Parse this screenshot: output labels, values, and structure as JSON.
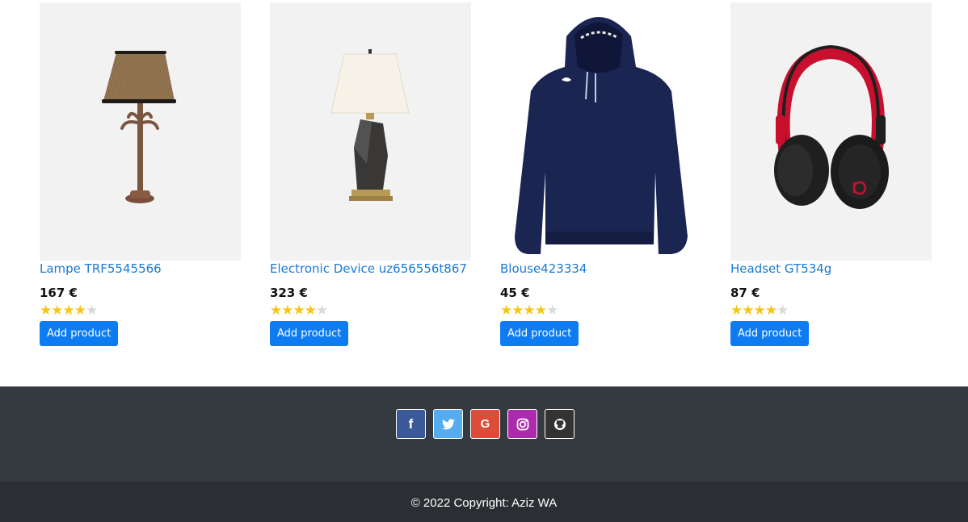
{
  "products": [
    {
      "title": "Lampe TRF5545566",
      "price": "167 €",
      "rating": 4,
      "max_rating": 5,
      "button": "Add product",
      "image_icon": "table-lamp-image"
    },
    {
      "title": "Electronic Device uz656556t867",
      "price": "323 €",
      "rating": 4,
      "max_rating": 5,
      "button": "Add product",
      "image_icon": "modern-lamp-image"
    },
    {
      "title": "Blouse423334",
      "price": "45 €",
      "rating": 4,
      "max_rating": 5,
      "button": "Add product",
      "image_icon": "navy-hoodie-image"
    },
    {
      "title": "Headset GT534g",
      "price": "87 €",
      "rating": 4,
      "max_rating": 5,
      "button": "Add product",
      "image_icon": "headphones-image"
    }
  ],
  "footer": {
    "social": [
      {
        "name": "facebook",
        "glyph": "f",
        "color": "#3b5998"
      },
      {
        "name": "twitter",
        "glyph": "t",
        "color": "#55acee"
      },
      {
        "name": "google",
        "glyph": "G",
        "color": "#dd4b39"
      },
      {
        "name": "instagram",
        "glyph": "◎",
        "color": "#ac2bac"
      },
      {
        "name": "github",
        "glyph": "●",
        "color": "#333333"
      }
    ],
    "copyright": "© 2022 Copyright: Aziz WA"
  },
  "colors": {
    "link": "#1a7ad6",
    "button": "#0d7bf1",
    "star": "#f5c518",
    "footer_top": "#343a40",
    "footer_bottom": "#2b2f33"
  }
}
